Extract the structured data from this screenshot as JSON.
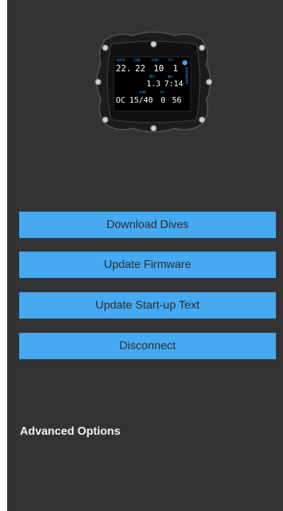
{
  "device": {
    "screen_labels": {
      "depth": "DEPTH",
      "time": "TIME",
      "stop": "STOP",
      "tts": "TTS",
      "max": "MAX",
      "ndl": "NDL",
      "surf": "SURF",
      "o2": "O2"
    },
    "row1": {
      "a": "22.",
      "b": "22",
      "c": "10",
      "d": "1"
    },
    "row2": {
      "a": "1.3",
      "b": "7:14"
    },
    "row3": {
      "a": "OC",
      "b": "15/40",
      "c": "0",
      "d": "56"
    },
    "brand": "SHEARWATER"
  },
  "buttons": {
    "download": "Download Dives",
    "firmware": "Update Firmware",
    "startup_text": "Update Start-up Text",
    "disconnect": "Disconnect"
  },
  "advanced": {
    "label": "Advanced Options"
  },
  "colors": {
    "background": "#333333",
    "button": "#45aaf2",
    "button_text": "#2b2b2b"
  }
}
